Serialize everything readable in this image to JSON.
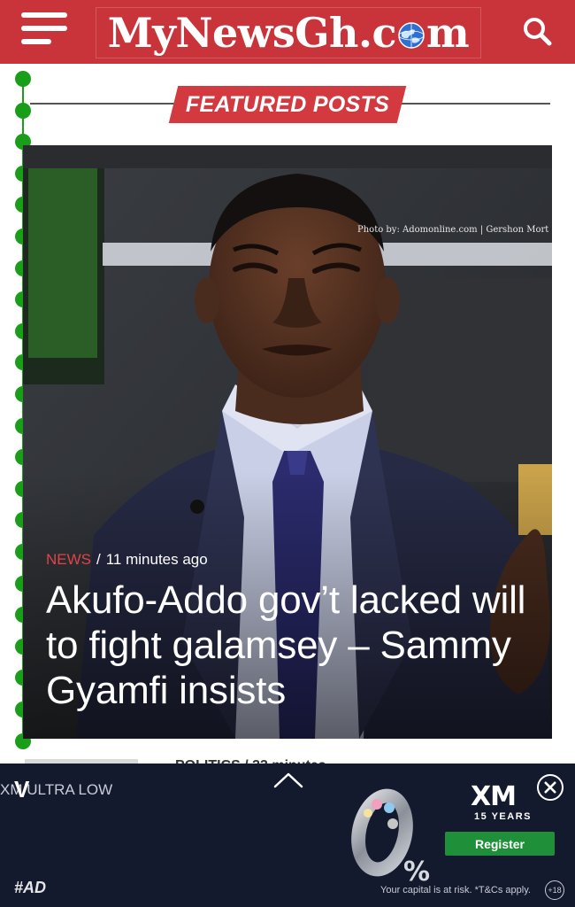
{
  "header": {
    "logo_before": "MyNewsGh.c",
    "logo_after": "m",
    "brand_color": "#c9343b"
  },
  "featured": {
    "label": "FEATURED POSTS",
    "post": {
      "category": "NEWS",
      "separator": "/",
      "time": "11 minutes ago",
      "headline": "Akufo-Addo gov’t lacked will to fight galamsey – Sammy Gyamfi insists",
      "photo_credit": "Photo by: Adomonline.com | Gershon Mort"
    }
  },
  "next_item": {
    "category_partial": "POLITICS / 33 minutes"
  },
  "ad": {
    "brand_text": "XM ULTRA LOW",
    "brand_initial": "V",
    "tag": "#AD",
    "logo": "XM",
    "logo_sub": "15 YEARS",
    "cta": "Register",
    "disclaimer": "Your capital is at risk. *T&Cs apply.",
    "age": "18",
    "cta_color": "#1f8f3a"
  },
  "icons": {
    "menu": "hamburger-icon",
    "search": "search-icon",
    "collapse": "chevron-up-icon",
    "close": "close-icon"
  }
}
